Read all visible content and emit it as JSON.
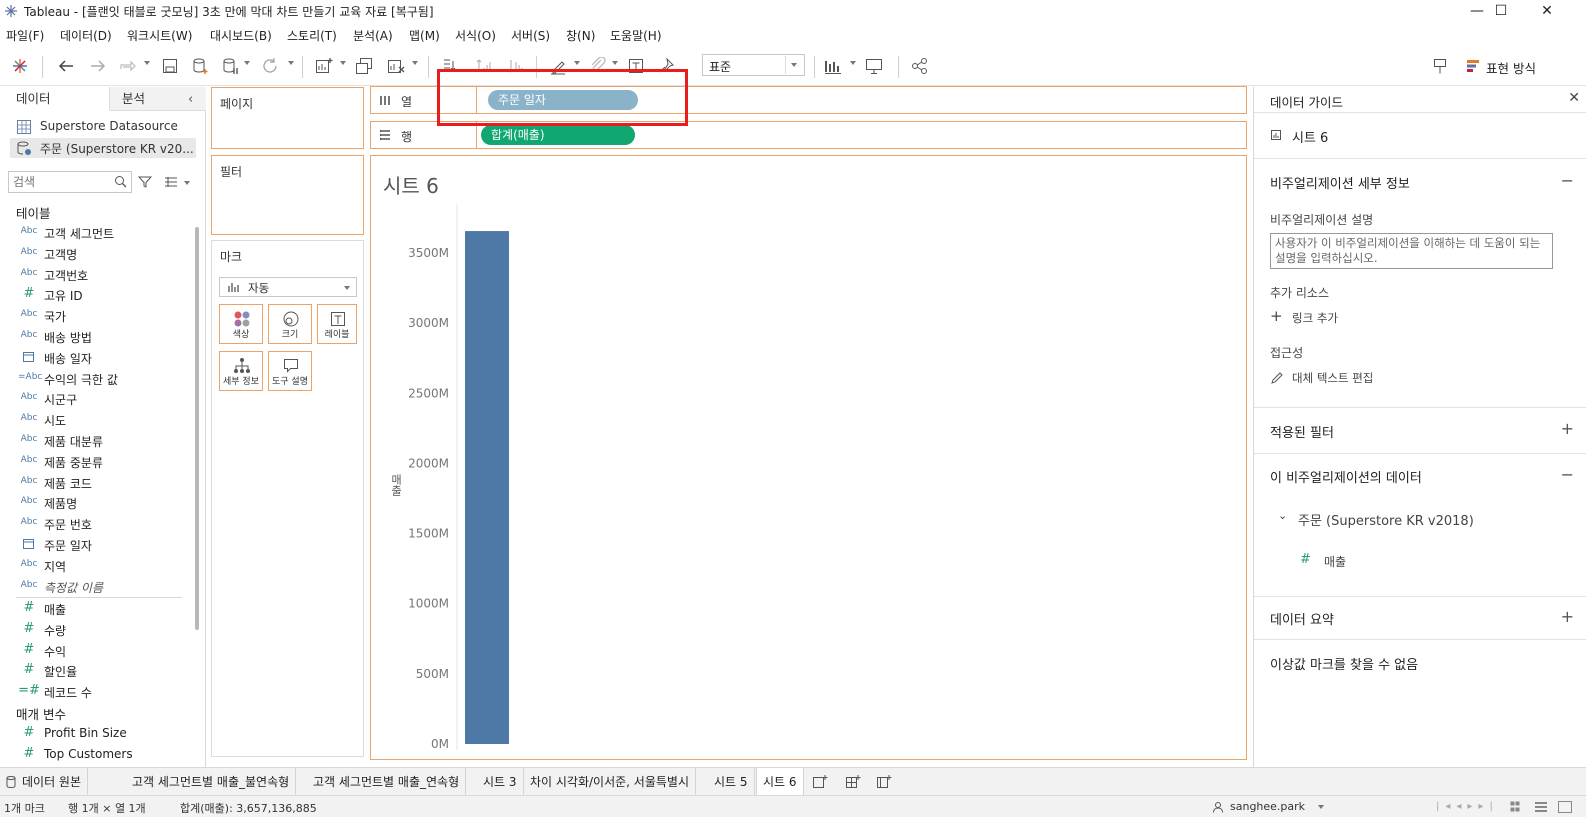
{
  "window": {
    "title": "Tableau - [플랜잇 태블로 굿모닝] 3초 만에 막대 차트 만들기 교육 자료 [복구됨]",
    "minimize": "—",
    "maximize": "☐",
    "close": "✕"
  },
  "menu": [
    "파일(F)",
    "데이터(D)",
    "워크시트(W)",
    "대시보드(B)",
    "스토리(T)",
    "분석(A)",
    "맵(M)",
    "서식(O)",
    "서버(S)",
    "창(N)",
    "도움말(H)"
  ],
  "toolbar": {
    "fit_value": "표준",
    "show_me": "표현 방식"
  },
  "datapane": {
    "tab_data": "데이터",
    "tab_analysis": "분석",
    "datasources": [
      "Superstore Datasource",
      "주문 (Superstore KR v20..."
    ],
    "search_placeholder": "검색",
    "tables_header": "테이블",
    "dimensions": [
      {
        "icon": "Abc",
        "label": "고객 세그먼트"
      },
      {
        "icon": "Abc",
        "label": "고객명"
      },
      {
        "icon": "Abc",
        "label": "고객번호"
      },
      {
        "icon": "#",
        "label": "고유 ID"
      },
      {
        "icon": "Abc",
        "label": "국가"
      },
      {
        "icon": "Abc",
        "label": "배송 방법"
      },
      {
        "icon": "cal",
        "label": "배송 일자"
      },
      {
        "icon": "=Abc",
        "label": "수익의 극한 값"
      },
      {
        "icon": "Abc",
        "label": "시군구"
      },
      {
        "icon": "Abc",
        "label": "시도"
      },
      {
        "icon": "Abc",
        "label": "제품 대분류"
      },
      {
        "icon": "Abc",
        "label": "제품 중분류"
      },
      {
        "icon": "Abc",
        "label": "제품 코드"
      },
      {
        "icon": "Abc",
        "label": "제품명"
      },
      {
        "icon": "Abc",
        "label": "주문 번호"
      },
      {
        "icon": "cal",
        "label": "주문 일자"
      },
      {
        "icon": "Abc",
        "label": "지역"
      },
      {
        "icon": "Abc",
        "label": "측정값 이름"
      }
    ],
    "measures": [
      {
        "icon": "#",
        "label": "매출"
      },
      {
        "icon": "#",
        "label": "수량"
      },
      {
        "icon": "#",
        "label": "수익"
      },
      {
        "icon": "#",
        "label": "할인율"
      },
      {
        "icon": "=#",
        "label": "레코드 수"
      }
    ],
    "params_header": "매개 변수",
    "params": [
      {
        "icon": "#",
        "label": "Profit Bin Size"
      },
      {
        "icon": "#",
        "label": "Top Customers"
      }
    ]
  },
  "cards": {
    "pages": "페이지",
    "filters": "필터",
    "marks": "마크",
    "mark_type": "자동",
    "mark_buttons": [
      "색상",
      "크기",
      "레이블",
      "세부 정보",
      "도구 설명"
    ]
  },
  "shelves": {
    "columns_label": "열",
    "rows_label": "행",
    "columns_pill": "주문 일자",
    "rows_pill": "합계(매출)"
  },
  "viz": {
    "sheet_title": "시트 6"
  },
  "chart_data": {
    "type": "bar",
    "categories": [
      ""
    ],
    "values": [
      3657136885
    ],
    "ylabel": "매출",
    "yticks": [
      "0M",
      "500M",
      "1000M",
      "1500M",
      "2000M",
      "2500M",
      "3000M",
      "3500M"
    ],
    "ylim": [
      0,
      3850000000
    ],
    "bar_color": "#4e79a7",
    "grid": false
  },
  "guide": {
    "title": "데이터 가이드",
    "sheet": "시트 6",
    "viz_details": "비주얼리제이션 세부 정보",
    "desc_label": "비주얼리제이션 설명",
    "desc_placeholder": "사용자가 이 비주얼리제이션을 이해하는 데 도움이 되는 설명을 입력하십시오.",
    "resources": "추가 리소스",
    "add_link": "링크 추가",
    "accessibility": "접근성",
    "edit_alt": "대체 텍스트 편집",
    "applied_filters": "적용된 필터",
    "viz_data": "이 비주얼리제이션의 데이터",
    "datasource": "주문 (Superstore KR v2018)",
    "field": "매출",
    "summary": "데이터 요약",
    "outliers": "이상값 마크를 찾을 수 없음"
  },
  "bottom_tabs": [
    "데이터 원본",
    "고객 세그먼트별 매출_불연속형",
    "고객 세그먼트별 매출_연속형",
    "시트 3",
    "차이 시각화/이서준, 서울특별시",
    "시트 5",
    "시트 6"
  ],
  "status": {
    "marks": "1개 마크",
    "rows_cols": "행 1개 × 열 1개",
    "sum": "합계(매출): 3,657,136,885",
    "user": "sanghee.park"
  },
  "colors": {
    "accent_orange": "#e8a46a",
    "pill_dimension": "#8ab3c9",
    "pill_measure": "#11a770",
    "highlight": "#e81e1e"
  }
}
